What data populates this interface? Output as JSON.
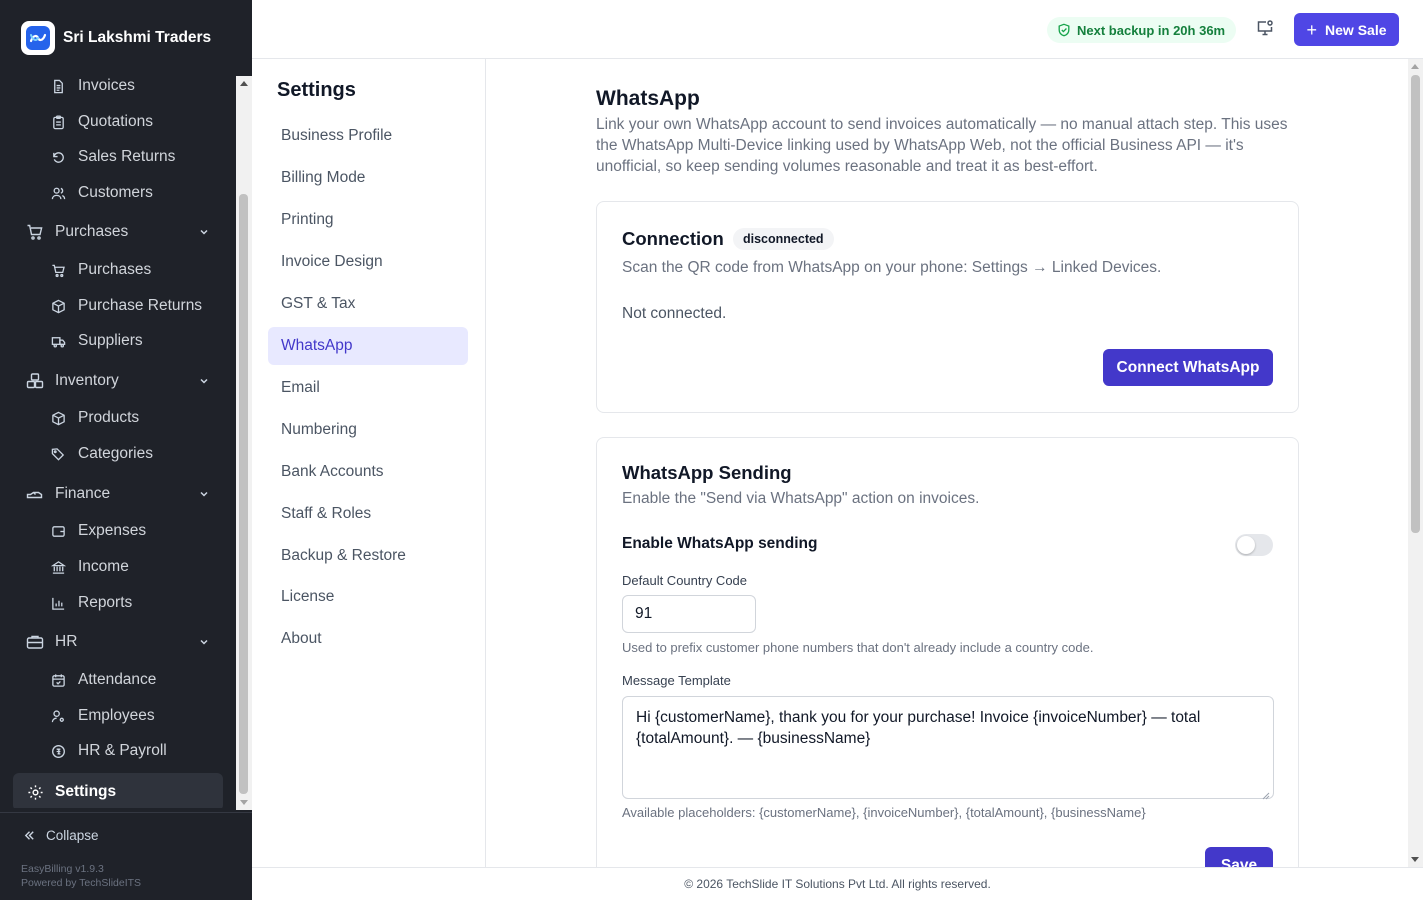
{
  "brand": {
    "name": "Sri Lakshmi Traders"
  },
  "sidebar": {
    "sales_items": [
      {
        "label": "Invoices",
        "icon": "file-text-icon"
      },
      {
        "label": "Quotations",
        "icon": "clipboard-icon"
      },
      {
        "label": "Sales Returns",
        "icon": "rotate-ccw-icon"
      },
      {
        "label": "Customers",
        "icon": "users-icon"
      }
    ],
    "purchases": {
      "label": "Purchases",
      "items": [
        "Purchases",
        "Purchase Returns",
        "Suppliers"
      ]
    },
    "inventory": {
      "label": "Inventory",
      "items": [
        "Products",
        "Categories"
      ]
    },
    "finance": {
      "label": "Finance",
      "items": [
        "Expenses",
        "Income",
        "Reports"
      ]
    },
    "hr": {
      "label": "HR",
      "items": [
        "Attendance",
        "Employees",
        "HR & Payroll"
      ]
    },
    "settings": {
      "label": "Settings"
    },
    "collapse_label": "Collapse",
    "version": "EasyBilling v1.9.3",
    "powered_by": "Powered by TechSlideITS"
  },
  "topbar": {
    "backup_status": "Next backup in 20h 36m",
    "new_sale_label": "New Sale"
  },
  "settings_nav": {
    "title": "Settings",
    "items": [
      "Business Profile",
      "Billing Mode",
      "Printing",
      "Invoice Design",
      "GST & Tax",
      "WhatsApp",
      "Email",
      "Numbering",
      "Bank Accounts",
      "Staff & Roles",
      "Backup & Restore",
      "License",
      "About"
    ],
    "active": "WhatsApp"
  },
  "page": {
    "title": "WhatsApp",
    "description": "Link your own WhatsApp account to send invoices automatically — no manual attach step. This uses the WhatsApp Multi-Device linking used by WhatsApp Web, not the official Business API — it's unofficial, so keep sending volumes reasonable and treat it as best-effort."
  },
  "connection": {
    "title": "Connection",
    "status": "disconnected",
    "instructions": "Scan the QR code from WhatsApp on your phone: Settings → Linked Devices.",
    "state_text": "Not connected.",
    "connect_label": "Connect WhatsApp"
  },
  "sending": {
    "title": "WhatsApp Sending",
    "subtitle": "Enable the \"Send via WhatsApp\" action on invoices.",
    "enable_label": "Enable WhatsApp sending",
    "enabled": false,
    "country_code_label": "Default Country Code",
    "country_code_value": "91",
    "country_code_hint": "Used to prefix customer phone numbers that don't already include a country code.",
    "template_label": "Message Template",
    "template_value": "Hi {customerName}, thank you for your purchase! Invoice {invoiceNumber} — total {totalAmount}. — {businessName}",
    "placeholders_hint": "Available placeholders: {customerName}, {invoiceNumber}, {totalAmount}, {businessName}",
    "save_label": "Save"
  },
  "footer": {
    "text": "© 2026 TechSlide IT Solutions Pvt Ltd. All rights reserved."
  },
  "colors": {
    "accent": "#4f46e5",
    "sidebar_bg": "#1f2229",
    "success": "#15803d"
  }
}
